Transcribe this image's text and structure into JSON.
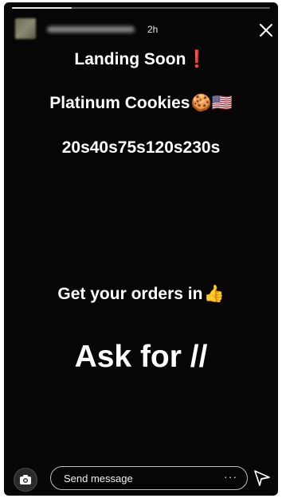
{
  "story": {
    "progress_fraction": 0.23,
    "timestamp": "2h",
    "lines": [
      {
        "text": "Landing Soon",
        "emoji": "❗"
      },
      {
        "text": "Platinum Cookies",
        "emoji": "🍪🇺🇸"
      },
      {
        "text": "20s40s75s120s230s",
        "emoji": ""
      },
      {
        "text": "Get your orders in",
        "emoji": "👍"
      },
      {
        "text": "Ask for //",
        "emoji": ""
      }
    ]
  },
  "icons": {
    "close": "close-icon",
    "camera": "camera-icon",
    "more": "more-options-icon",
    "send": "send-icon"
  },
  "footer": {
    "message_placeholder": "Send message",
    "more_label": "···"
  },
  "colors": {
    "background": "#060606",
    "text": "#ffffff",
    "input_border": "#bdbdbd"
  }
}
